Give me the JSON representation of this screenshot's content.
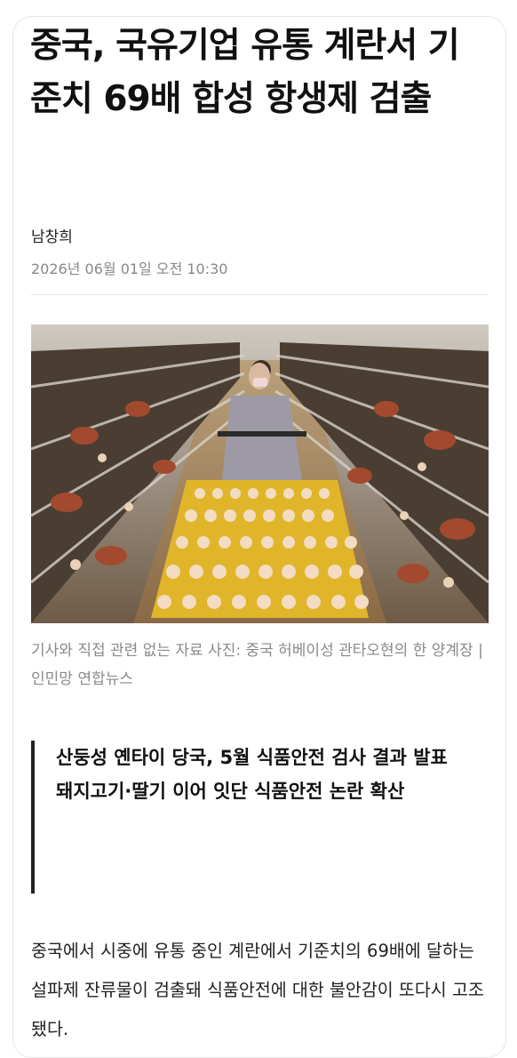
{
  "article": {
    "headline": "중국, 국유기업 유통 계란서 기준치 69배 합성 항생제 검출",
    "author": "남창희",
    "date": "2026년 06월 01일 오전 10:30",
    "photo": {
      "caption": "기사와 직접 관련 없는 자료 사진: 중국 허베이성 관타오현의 한 양계장 | 인민망 연합뉴스"
    },
    "summary": [
      "산둥성 옌타이 당국, 5월 식품안전 검사 결과 발표",
      "돼지고기·딸기 이어 잇단 식품안전 논란 확산"
    ],
    "body": "중국에서 시중에 유통 중인 계란에서 기준치의 69배에 달하는 설파제 잔류물이 검출돼 식품안전에 대한 불안감이 또다시 고조됐다."
  }
}
